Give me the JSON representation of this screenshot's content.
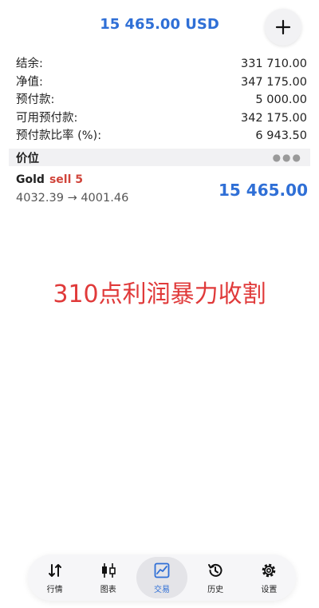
{
  "header": {
    "title": "15 465.00 USD"
  },
  "summary": [
    {
      "label": "结余:",
      "value": "331 710.00"
    },
    {
      "label": "净值:",
      "value": "347 175.00"
    },
    {
      "label": "预付款:",
      "value": "5 000.00"
    },
    {
      "label": "可用预付款:",
      "value": "342 175.00"
    },
    {
      "label": "预付款比率 (%):",
      "value": "6 943.50"
    }
  ],
  "section": {
    "title": "价位",
    "menu_icon": "more-dots-icon"
  },
  "position": {
    "symbol": "Gold",
    "direction": "sell 5",
    "prices": "4032.39 → 4001.46",
    "profit": "15 465.00"
  },
  "overlay_text": "310点利润暴力收割",
  "tabs": [
    {
      "label": "行情",
      "icon": "quotes-arrows-icon"
    },
    {
      "label": "图表",
      "icon": "candlestick-chart-icon"
    },
    {
      "label": "交易",
      "icon": "trade-chart-icon",
      "active": true
    },
    {
      "label": "历史",
      "icon": "history-clock-icon"
    },
    {
      "label": "设置",
      "icon": "settings-gear-icon"
    }
  ],
  "colors": {
    "accent": "#2f6fd6",
    "sell": "#d0443a",
    "overlay": "#e03a3a"
  }
}
